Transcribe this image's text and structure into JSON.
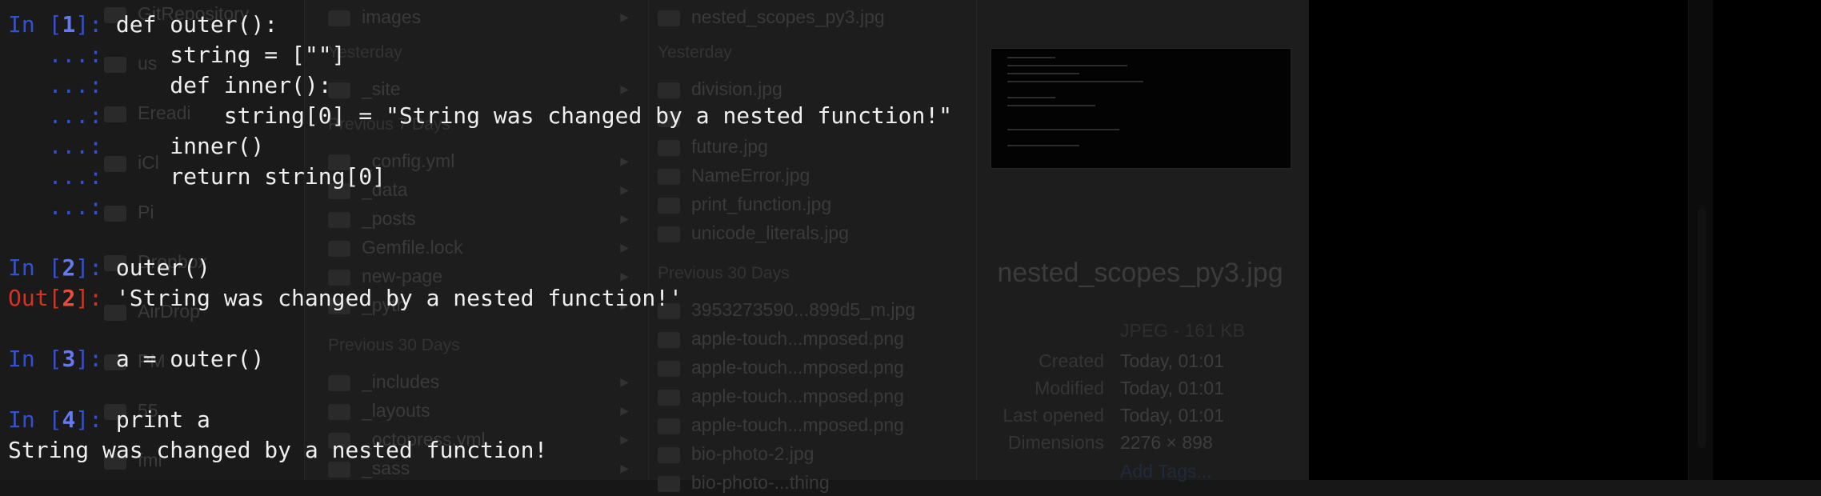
{
  "finder": {
    "sidebar": [
      {
        "label": "GitRepository",
        "icon": "folder-icon"
      },
      {
        "label": "us",
        "icon": "folder-icon"
      },
      {
        "label": "Ereadi",
        "icon": "folder-icon"
      },
      {
        "label": "iCl",
        "icon": "cloud-icon"
      },
      {
        "label": "Pi",
        "icon": "folder-icon"
      },
      {
        "label": "Dropbox",
        "icon": "folder-icon"
      },
      {
        "label": "AirDrop",
        "icon": "airdrop-icon"
      },
      {
        "label": "PM",
        "icon": "folder-icon"
      },
      {
        "label": "55",
        "icon": "folder-icon"
      },
      {
        "label": "fml",
        "icon": "folder-icon"
      }
    ],
    "col2": {
      "top_item": "images",
      "yesterday_header": "Yesterday",
      "yesterday_items": [
        "_site"
      ],
      "prev7_header": "Previous 7 Days",
      "prev7_items": [
        "_config.yml",
        "_data",
        "_posts",
        "Gemfile.lock",
        "new-page",
        "_pyth"
      ],
      "prev30_header": "Previous 30 Days",
      "prev30_items": [
        "_includes",
        "_layouts",
        "_octopress.yml",
        "_sass"
      ]
    },
    "col3": {
      "top_item": "nested_scopes_py3.jpg",
      "yesterday_header": "Yesterday",
      "yesterday_items": [
        "division.jpg",
        "",
        "future.jpg",
        "NameError.jpg",
        "print_function.jpg",
        "unicode_literals.jpg"
      ],
      "prev30_header": "Previous 30 Days",
      "prev30_items": [
        "3953273590...899d5_m.jpg",
        "apple-touch...mposed.png",
        "apple-touch...mposed.png",
        "apple-touch...mposed.png",
        "apple-touch...mposed.png",
        "bio-photo-2.jpg",
        "bio-photo-...thing"
      ]
    },
    "preview": {
      "filename": "nested_scopes_py3.jpg",
      "kind": "JPEG - 161 KB",
      "meta": [
        {
          "key": "Created",
          "value": "Today, 01:01"
        },
        {
          "key": "Modified",
          "value": "Today, 01:01"
        },
        {
          "key": "Last opened",
          "value": "Today, 01:01"
        },
        {
          "key": "Dimensions",
          "value": "2276 × 898"
        }
      ],
      "add_tags": "Add Tags..."
    }
  },
  "terminal": {
    "in_label": "In ",
    "out_label": "Out",
    "colon": ": ",
    "cont": "   ...: ",
    "cells": [
      {
        "n": "1",
        "lines": [
          "def outer():",
          "    string = [\"\"]",
          "    def inner():",
          "        string[0] = \"String was changed by a nested function!\"",
          "    inner()",
          "    return string[0]",
          ""
        ]
      },
      {
        "n": "2",
        "lines": [
          "outer()"
        ],
        "out": "'String was changed by a nested function!'"
      },
      {
        "n": "3",
        "lines": [
          "a = outer()"
        ]
      },
      {
        "n": "4",
        "lines": [
          "print a"
        ],
        "stdout": "String was changed by a nested function!"
      }
    ]
  }
}
